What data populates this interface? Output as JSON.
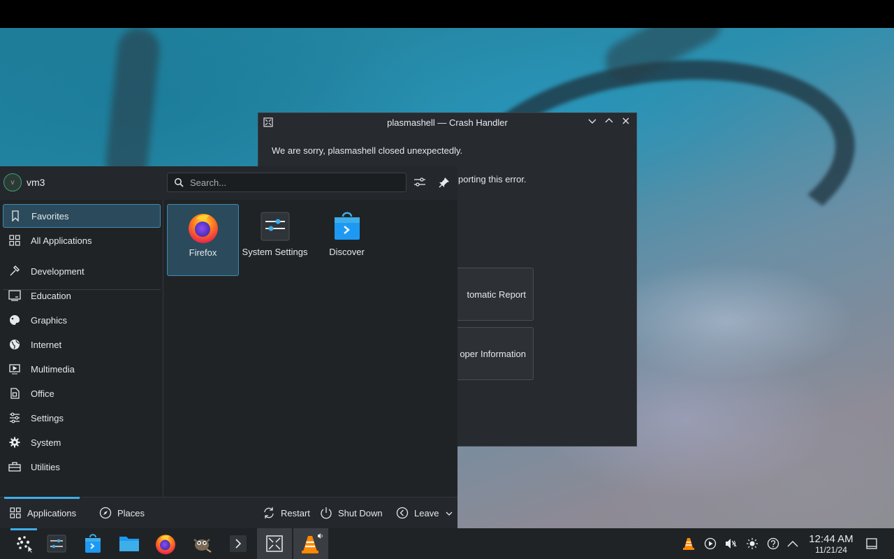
{
  "crash_dialog": {
    "title": "plasmashell — Crash Handler",
    "message": "We are sorry, plasmashell closed unexpectedly.",
    "message_partial": "porting this error.",
    "report_button": "tomatic Report",
    "developer_button": "oper Information",
    "icons": {
      "app": "crash-handler-icon",
      "minimize": "chevron-down-icon",
      "maximize": "chevron-up-icon",
      "close": "close-icon"
    }
  },
  "launcher": {
    "username": "vm3",
    "avatar_initial": "v",
    "search_placeholder": "Search...",
    "configure_icon": "sliders-icon",
    "pin_icon": "pin-icon",
    "sidebar": [
      {
        "label": "Favorites",
        "icon": "bookmark-icon",
        "active": true
      },
      {
        "label": "All Applications",
        "icon": "grid-icon"
      },
      {
        "label": "Development",
        "icon": "hammer-icon"
      },
      {
        "label": "Education",
        "icon": "board-icon"
      },
      {
        "label": "Graphics",
        "icon": "palette-icon"
      },
      {
        "label": "Internet",
        "icon": "globe-icon"
      },
      {
        "label": "Multimedia",
        "icon": "media-icon"
      },
      {
        "label": "Office",
        "icon": "document-icon"
      },
      {
        "label": "Settings",
        "icon": "sliders-icon"
      },
      {
        "label": "System",
        "icon": "gear-icon"
      },
      {
        "label": "Utilities",
        "icon": "toolbox-icon"
      }
    ],
    "favorites": [
      {
        "label": "Firefox",
        "icon": "firefox-icon",
        "active": true
      },
      {
        "label": "System Settings",
        "icon": "system-settings-icon"
      },
      {
        "label": "Discover",
        "icon": "discover-icon"
      }
    ],
    "footer": {
      "applications": "Applications",
      "places": "Places",
      "restart": "Restart",
      "shutdown": "Shut Down",
      "leave": "Leave"
    }
  },
  "taskbar": {
    "items": [
      "application-launcher-icon",
      "system-settings-icon",
      "discover-icon",
      "files-icon",
      "firefox-icon",
      "gimp-icon",
      "terminal-icon",
      "crash-handler-icon",
      "vlc-icon"
    ],
    "tray": [
      "vlc-tray-icon",
      "media-play-icon",
      "volume-muted-icon",
      "brightness-icon",
      "help-icon",
      "expand-tray-icon"
    ],
    "clock_time": "12:44 AM",
    "clock_date": "11/21/24",
    "show_desktop_icon": "show-desktop-icon"
  }
}
